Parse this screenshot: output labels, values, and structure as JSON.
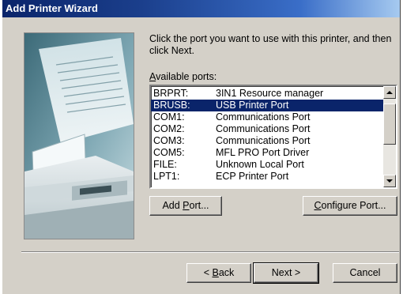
{
  "window": {
    "title": "Add Printer Wizard"
  },
  "prompt": {
    "text": "Click the port you want to use with this printer, and then click Next."
  },
  "ports": {
    "label_accel": "A",
    "label_rest": "vailable ports:",
    "items": [
      {
        "port": "BRPRT:",
        "desc": "3IN1 Resource manager",
        "selected": false
      },
      {
        "port": "BRUSB:",
        "desc": "USB Printer Port",
        "selected": true
      },
      {
        "port": "COM1:",
        "desc": "Communications Port",
        "selected": false
      },
      {
        "port": "COM2:",
        "desc": "Communications Port",
        "selected": false
      },
      {
        "port": "COM3:",
        "desc": "Communications Port",
        "selected": false
      },
      {
        "port": "COM5:",
        "desc": "MFL PRO Port Driver",
        "selected": false
      },
      {
        "port": "FILE:",
        "desc": "Unknown Local Port",
        "selected": false
      },
      {
        "port": "LPT1:",
        "desc": "ECP Printer Port",
        "selected": false
      }
    ]
  },
  "buttons": {
    "add_port": {
      "pre": "Add ",
      "accel": "P",
      "post": "ort..."
    },
    "configure_port": {
      "pre": "",
      "accel": "C",
      "post": "onfigure Port..."
    },
    "back": {
      "pre": "< ",
      "accel": "B",
      "post": "ack"
    },
    "next": {
      "label": "Next >"
    },
    "cancel": {
      "label": "Cancel"
    }
  },
  "colors": {
    "title_bar_start": "#0a246a",
    "title_bar_end": "#a6caf0",
    "selection": "#0a246a",
    "dialog_face": "#d4d0c8"
  },
  "icons": [
    "scroll-up-arrow-icon",
    "scroll-down-arrow-icon"
  ]
}
